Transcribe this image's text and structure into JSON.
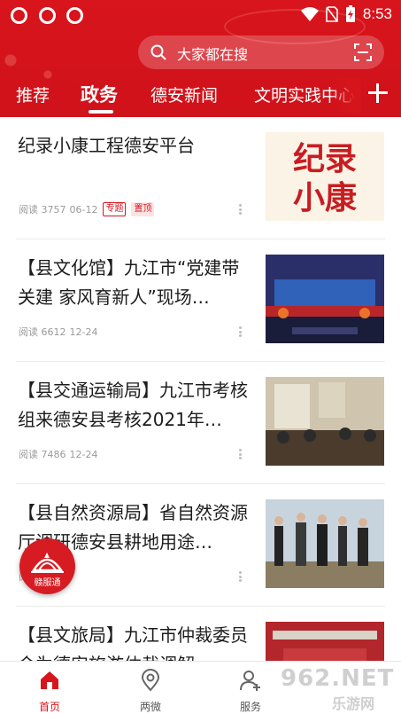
{
  "status_bar": {
    "time": "8:53"
  },
  "search": {
    "placeholder": "大家都在搜"
  },
  "tabs": [
    {
      "label": "推荐"
    },
    {
      "label": "政务"
    },
    {
      "label": "德安新闻"
    },
    {
      "label": "文明实践中心"
    }
  ],
  "active_tab": "政务",
  "articles": [
    {
      "title": "纪录小康工程德安平台",
      "reads": "阅读 3757",
      "date": "06-12",
      "badge_topic": "专题",
      "badge_pinned": "置顶",
      "thumb_text_1": "纪录",
      "thumb_text_2": "小康"
    },
    {
      "title": "【县文化馆】九江市“党建带关建 家风育新人”现场…",
      "reads": "阅读 6612",
      "date": "12-24"
    },
    {
      "title": "【县交通运输局】九江市考核组来德安县考核2021年…",
      "reads": "阅读 7486",
      "date": "12-24"
    },
    {
      "title": "【县自然资源局】省自然资源厅调研德安县耕地用途…",
      "reads": "阅读",
      "date": "12-24"
    },
    {
      "title": "【县文旅局】九江市仲裁委员会为德安旅游仲裁调解…"
    }
  ],
  "floating_button": {
    "label": "赣服通"
  },
  "bottom_nav": [
    {
      "label": "首页"
    },
    {
      "label": "两微"
    },
    {
      "label": "服务"
    }
  ],
  "watermark": {
    "text": "962.NET",
    "sub": "乐游网"
  },
  "colors": {
    "brand_red": "#d8141c",
    "tab_active": "#ffffff",
    "meta_gray": "#9a9a9a"
  }
}
